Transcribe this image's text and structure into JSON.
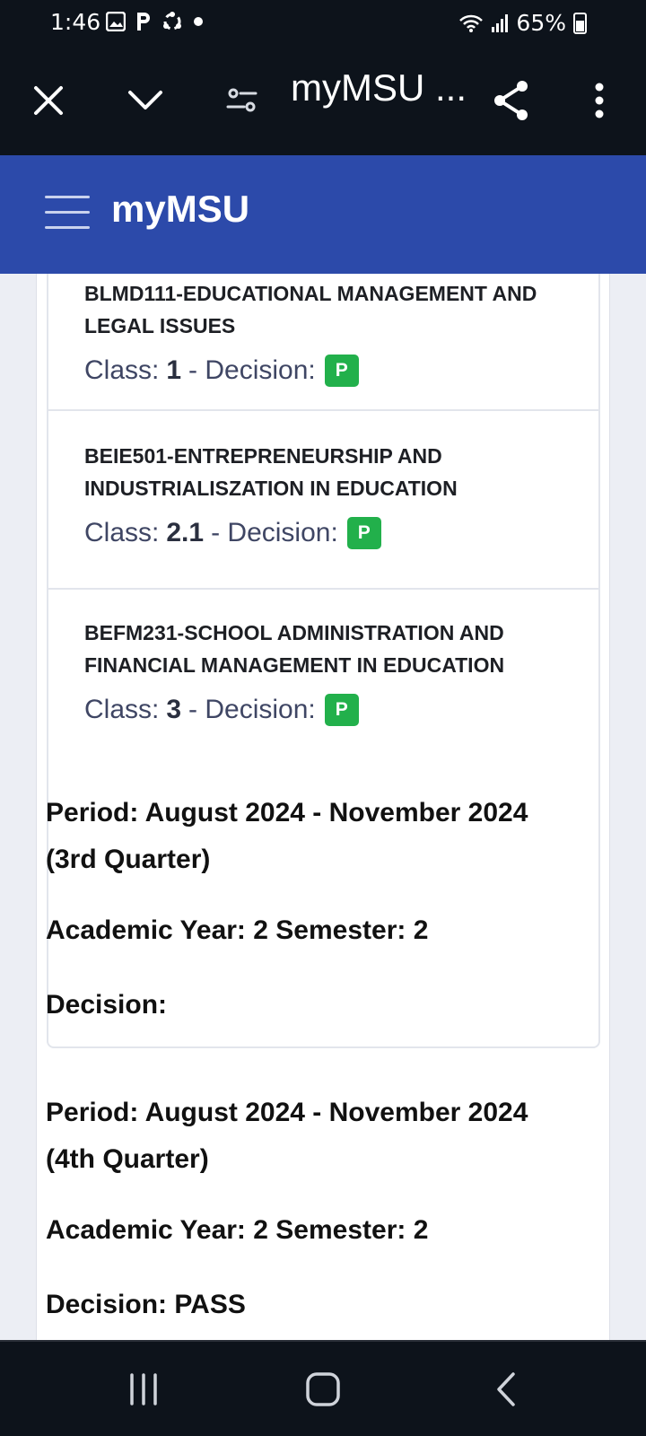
{
  "status_bar": {
    "time": "1:46",
    "battery": "65%",
    "icons_left": [
      "gallery-icon",
      "p-icon",
      "sync-icon",
      "dot-icon"
    ],
    "icons_right": [
      "wifi-icon",
      "signal-icon",
      "battery-icon"
    ]
  },
  "browser_toolbar": {
    "title": "myMSU ..."
  },
  "app_header": {
    "title": "myMSU"
  },
  "courses": [
    {
      "name": "BLMD111-EDUCATIONAL MANAGEMENT AND LEGAL ISSUES",
      "class_label": "Class:",
      "class_value": "1",
      "decision_label": "- Decision:",
      "decision": "P"
    },
    {
      "name": "BEIE501-ENTREPRENEURSHIP AND INDUSTRIALISZATION IN EDUCATION",
      "class_label": "Class:",
      "class_value": "2.1",
      "decision_label": "- Decision:",
      "decision": "P"
    },
    {
      "name": "BEFM231-SCHOOL ADMINISTRATION AND FINANCIAL MANAGEMENT IN EDUCATION",
      "class_label": "Class:",
      "class_value": "3",
      "decision_label": "- Decision:",
      "decision": "P"
    }
  ],
  "periods": [
    {
      "period_line1": "Period: August 2024 - November 2024",
      "period_line2": "(3rd Quarter)",
      "academic": "Academic Year: 2 Semester: 2",
      "decision": "Decision:"
    },
    {
      "period_line1": "Period: August 2024 - November 2024",
      "period_line2": "(4th Quarter)",
      "academic": "Academic Year: 2 Semester: 2",
      "decision": "Decision: PASS"
    }
  ],
  "colors": {
    "header_blue": "#2c4aaa",
    "pass_badge": "#22b04b",
    "system_bar": "#0d131b"
  }
}
